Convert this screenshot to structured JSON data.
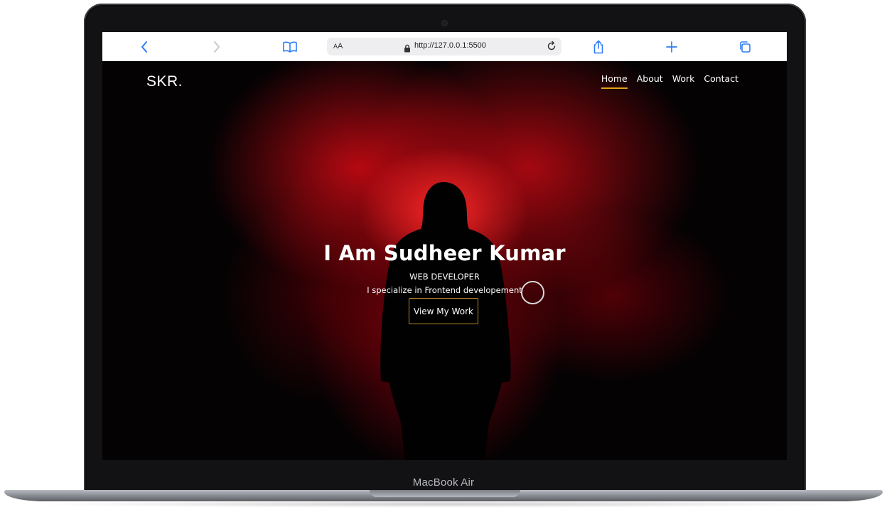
{
  "device": {
    "label": "MacBook Air"
  },
  "browser": {
    "address": {
      "aa_small": "A",
      "aa_big": "A",
      "url": "http://127.0.0.1:5500"
    },
    "icons": [
      "back-icon",
      "forward-icon",
      "bookmarks-icon",
      "lock-icon",
      "reload-icon",
      "share-icon",
      "new-tab-icon",
      "tabs-icon"
    ]
  },
  "site": {
    "logo": "SKR.",
    "nav": [
      {
        "label": "Home",
        "active": true
      },
      {
        "label": "About",
        "active": false
      },
      {
        "label": "Work",
        "active": false
      },
      {
        "label": "Contact",
        "active": false
      }
    ],
    "hero": {
      "title": "I Am Sudheer Kumar",
      "subtitle": "WEB DEVELOPER",
      "description": "I specialize in Frontend developement",
      "cta_label": "View My Work"
    },
    "colors": {
      "accent": "#e4a11b",
      "background": "#050203",
      "smoke": "#d0101a"
    }
  }
}
